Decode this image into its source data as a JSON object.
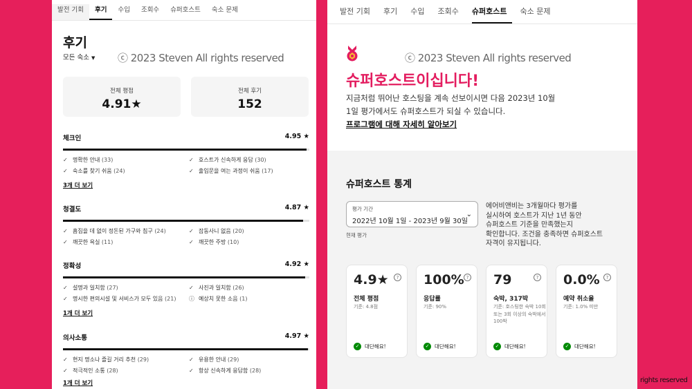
{
  "left": {
    "tabs": [
      "발전 기회",
      "후기",
      "수입",
      "조회수",
      "슈퍼호스트",
      "숙소 문제"
    ],
    "title": "후기",
    "filter": "모든 숙소",
    "watermark": "ⓒ 2023 Steven All rights reserved",
    "overall": {
      "label": "전체 평점",
      "value": "4.91★"
    },
    "total_reviews": {
      "label": "전체 후기",
      "value": "152"
    },
    "categories": [
      {
        "name": "체크인",
        "score": "4.95 ★",
        "rating": 4.95,
        "items": [
          [
            "명확한 안내",
            "(33)"
          ],
          [
            "호스트가 신속하게 응답",
            "(30)"
          ],
          [
            "숙소를 찾기 쉬움",
            "(24)"
          ],
          [
            "출입문을 여는 과정이 쉬움",
            "(17)"
          ]
        ],
        "more": "3개 더 보기"
      },
      {
        "name": "청결도",
        "score": "4.87 ★",
        "rating": 4.87,
        "items": [
          [
            "흠집을 데 없이 정돈된 가구와 침구",
            "(24)"
          ],
          [
            "잡동사니 없음",
            "(20)"
          ],
          [
            "깨끗한 욕실",
            "(11)"
          ],
          [
            "깨끗한 주방",
            "(10)"
          ]
        ],
        "more": null
      },
      {
        "name": "정확성",
        "score": "4.92 ★",
        "rating": 4.92,
        "items": [
          [
            "설명과 일치함",
            "(27)"
          ],
          [
            "사진과 일치함",
            "(26)"
          ],
          [
            "명시한 편의시설 및 서비스가 모두 있음",
            "(21)"
          ],
          [
            "예상치 못한 소음",
            "(1)"
          ]
        ],
        "more": "1개 더 보기"
      },
      {
        "name": "의사소통",
        "score": "4.97 ★",
        "rating": 4.97,
        "items": [
          [
            "현지 명소나 즐길 거리 추천",
            "(29)"
          ],
          [
            "유용한 안내",
            "(29)"
          ],
          [
            "적극적인 소통",
            "(28)"
          ],
          [
            "항상 신속하게 응답함",
            "(28)"
          ]
        ],
        "more": "1개 더 보기"
      }
    ]
  },
  "right": {
    "tabs": [
      "발전 기회",
      "후기",
      "수입",
      "조회수",
      "슈퍼호스트",
      "숙소 문제"
    ],
    "watermark": "ⓒ 2023 Steven All rights reserved",
    "headline": "슈퍼호스트이십니다!",
    "desc_line1": "지금처럼 뛰어난 호스팅을 계속 선보이시면 다음 2023년 10월",
    "desc_line2": "1일 평가에서도 슈퍼호스트가 되실 수 있습니다.",
    "link": "프로그램에 대해 자세히 알아보기",
    "stats_title": "슈퍼호스트 통계",
    "period_label": "평가 기간",
    "period_value": "2022년 10월 1일 - 2023년 9월 30일",
    "period_note": "현재 평가",
    "info_line1": "에어비앤비는 3개월마다 평가를",
    "info_line2": "실시하여 호스트가 지난 1년 동안",
    "info_line3": "슈퍼호스트 기준을 만족했는지",
    "info_line4": "확인합니다. 조건을 충족하면 슈퍼호스트",
    "info_line5": "자격이 유지됩니다.",
    "cards": [
      {
        "value": "4.9★",
        "label": "전체 평점",
        "sub": "기준: 4.8점",
        "status": "대단해요!"
      },
      {
        "value": "100%",
        "label": "응답률",
        "sub": "기준: 90%",
        "status": "대단해요!"
      },
      {
        "value": "79",
        "label": "숙박, 317박",
        "sub": "기준: 호스팅한 숙박 10회 또는 3회 이상의 숙박에서 100박",
        "status": "대단해요!"
      },
      {
        "value": "0.0%",
        "label": "예약 취소율",
        "sub": "기준: 1.0% 미만",
        "status": "대단해요!"
      }
    ]
  },
  "corner_watermark": "rights reserved",
  "colors": {
    "brand": "#e31c5f",
    "background": "#e61f5b",
    "success": "#008a05"
  }
}
